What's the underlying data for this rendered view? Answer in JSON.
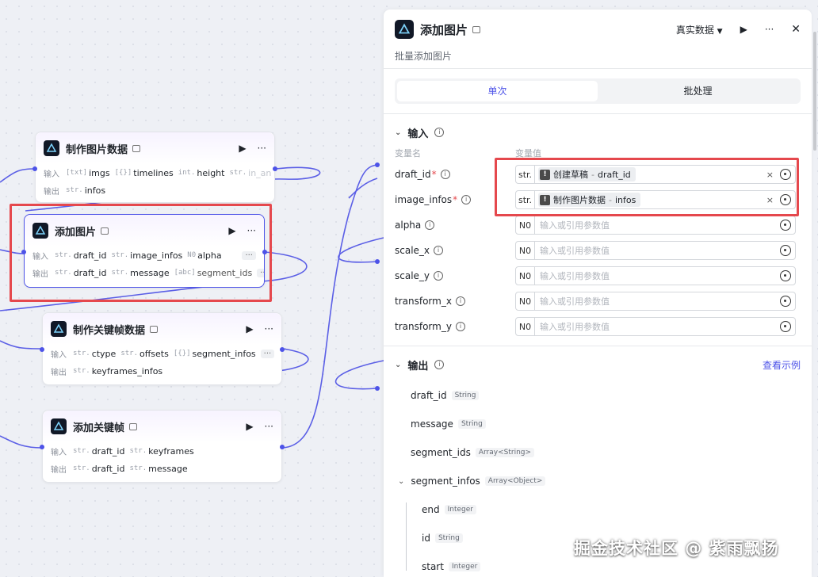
{
  "canvas": {
    "nodes": [
      {
        "title": "制作图片数据",
        "inputs": [
          {
            "type": "[txt]",
            "name": "imgs"
          },
          {
            "type": "[{}]",
            "name": "timelines"
          },
          {
            "type": "int.",
            "name": "height"
          },
          {
            "type": "str.",
            "name": "in_an"
          }
        ],
        "outputs": [
          {
            "type": "str.",
            "name": "infos"
          }
        ]
      },
      {
        "title": "添加图片",
        "inputs": [
          {
            "type": "str.",
            "name": "draft_id"
          },
          {
            "type": "str.",
            "name": "image_infos"
          },
          {
            "type": "N0",
            "name": "alpha"
          }
        ],
        "outputs": [
          {
            "type": "str.",
            "name": "draft_id"
          },
          {
            "type": "str.",
            "name": "message"
          },
          {
            "type": "[abc]",
            "name": "segment_ids"
          }
        ]
      },
      {
        "title": "制作关键帧数据",
        "inputs": [
          {
            "type": "str.",
            "name": "ctype"
          },
          {
            "type": "str.",
            "name": "offsets"
          },
          {
            "type": "[{}]",
            "name": "segment_infos"
          }
        ],
        "outputs": [
          {
            "type": "str.",
            "name": "keyframes_infos"
          }
        ]
      },
      {
        "title": "添加关键帧",
        "inputs": [
          {
            "type": "str.",
            "name": "draft_id"
          },
          {
            "type": "str.",
            "name": "keyframes"
          }
        ],
        "outputs": [
          {
            "type": "str.",
            "name": "draft_id"
          },
          {
            "type": "str.",
            "name": "message"
          }
        ]
      }
    ],
    "row_labels": {
      "input": "输入",
      "output": "输出"
    },
    "more": "···",
    "run_glyph": "▶",
    "menu_glyph": "···"
  },
  "panel": {
    "title": "添加图片",
    "subtitle": "批量添加图片",
    "data_mode": "真实数据",
    "dropdown_glyph": "▼",
    "run_glyph": "▶",
    "more_glyph": "···",
    "close_glyph": "✕",
    "tabs": [
      "单次",
      "批处理"
    ],
    "input_section": "输入",
    "col_name": "变量名",
    "col_value": "变量值",
    "params": [
      {
        "name": "draft_id",
        "required": true,
        "type": "str.",
        "ref_node": "创建草稿",
        "ref_field": "draft_id"
      },
      {
        "name": "image_infos",
        "required": true,
        "type": "str.",
        "ref_node": "制作图片数据",
        "ref_field": "infos"
      },
      {
        "name": "alpha",
        "required": false,
        "type": "N0",
        "placeholder": "输入或引用参数值"
      },
      {
        "name": "scale_x",
        "required": false,
        "type": "N0",
        "placeholder": "输入或引用参数值"
      },
      {
        "name": "scale_y",
        "required": false,
        "type": "N0",
        "placeholder": "输入或引用参数值"
      },
      {
        "name": "transform_x",
        "required": false,
        "type": "N0",
        "placeholder": "输入或引用参数值"
      },
      {
        "name": "transform_y",
        "required": false,
        "type": "N0",
        "placeholder": "输入或引用参数值"
      }
    ],
    "ref_separator": " - ",
    "required_mark": "*",
    "clear_glyph": "×",
    "info_glyph": "i",
    "output_section": "输出",
    "view_example": "查看示例",
    "outputs": [
      {
        "name": "draft_id",
        "type": "String"
      },
      {
        "name": "message",
        "type": "String"
      },
      {
        "name": "segment_ids",
        "type": "Array<String>"
      },
      {
        "name": "segment_infos",
        "type": "Array<Object>",
        "children": [
          {
            "name": "end",
            "type": "Integer"
          },
          {
            "name": "id",
            "type": "String"
          },
          {
            "name": "start",
            "type": "Integer"
          }
        ]
      }
    ]
  },
  "watermark": "掘金技术社区 @ 紫雨飘扬",
  "colors": {
    "accent": "#4d53e8",
    "highlight_box": "#e5484d",
    "edge": "#5b5fe6"
  }
}
